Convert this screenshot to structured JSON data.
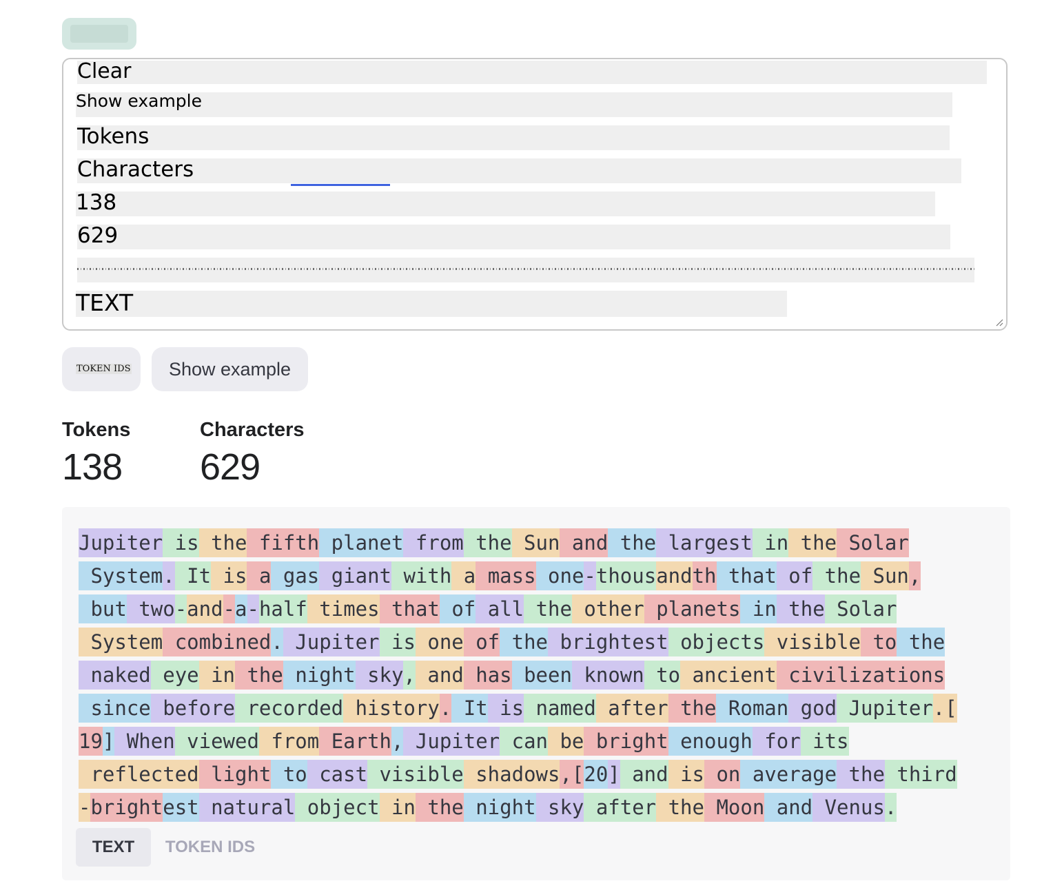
{
  "textarea": {
    "lines": [
      "Clear",
      "Show example",
      "Tokens",
      "Characters",
      "138",
      "629",
      "TEXT"
    ]
  },
  "buttons": {
    "token_ids_label": "TOKEN IDS",
    "show_example_label": "Show example"
  },
  "stats": {
    "tokens_label": "Tokens",
    "tokens_value": "138",
    "characters_label": "Characters",
    "characters_value": "629"
  },
  "tokens": [
    "Jupiter",
    " is",
    " the",
    " fifth",
    " planet",
    " from",
    " the",
    " Sun",
    " and",
    " the",
    " largest",
    " in",
    " the",
    " Solar",
    "\n",
    " System",
    ".",
    " It",
    " is",
    " a",
    " gas",
    " giant",
    " with",
    " a",
    " mass",
    " one",
    "-",
    "thous",
    "and",
    "th",
    " that",
    " of",
    " the",
    " Sun",
    ",",
    "\n",
    " but",
    " two",
    "-",
    "and",
    "-",
    "a",
    "-",
    "half",
    " times",
    " that",
    " of",
    " all",
    " the",
    " other",
    " planets",
    " in",
    " the",
    " Solar",
    "\n",
    " System",
    " combined",
    ".",
    " Jupiter",
    " is",
    " one",
    " of",
    " the",
    " brightest",
    " objects",
    " visible",
    " to",
    " the",
    "\n",
    " naked",
    " eye",
    " in",
    " the",
    " night",
    " sky",
    ",",
    " and",
    " has",
    " been",
    " known",
    " to",
    " ancient",
    " civilizations",
    "\n",
    " since",
    " before",
    " recorded",
    " history",
    ".",
    " It",
    " is",
    " named",
    " after",
    " the",
    " Roman",
    " god",
    " Jupiter",
    ".[",
    "\n",
    "19",
    "]",
    " When",
    " viewed",
    " from",
    " Earth",
    ",",
    " Jupiter",
    " can",
    " be",
    " bright",
    " enough",
    " for",
    " its",
    "\n",
    " reflected",
    " light",
    " to",
    " cast",
    " visible",
    " shadows",
    ",[",
    "20",
    "]",
    " and",
    " is",
    " on",
    " average",
    " the",
    " third",
    "\n",
    "-",
    "bright",
    "est",
    " natural",
    " object",
    " in",
    " the",
    " night",
    " sky",
    " after",
    " the",
    " Moon",
    " and",
    " Venus",
    "."
  ],
  "token_colors": [
    "#d0c7f0",
    "#c8ebd0",
    "#f3d9b1",
    "#f0b8b8",
    "#b7dcf0"
  ],
  "tabs": {
    "text_label": "TEXT",
    "token_ids_label": "TOKEN IDS"
  }
}
